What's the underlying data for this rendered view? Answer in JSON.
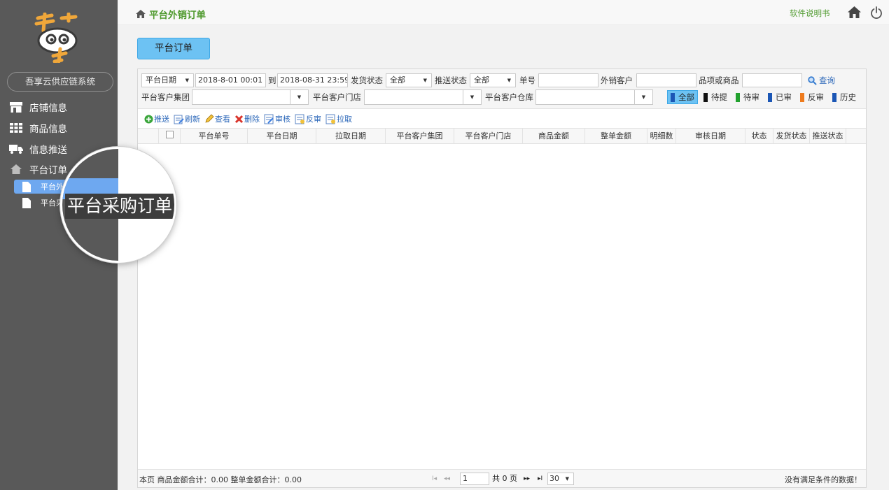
{
  "sidebar": {
    "system_name": "吾享云供应链系统",
    "menu": [
      {
        "label": "店铺信息",
        "icon": "store-icon"
      },
      {
        "label": "商品信息",
        "icon": "grid-icon"
      },
      {
        "label": "信息推送",
        "icon": "truck-icon"
      },
      {
        "label": "平台订单",
        "icon": "house-icon"
      }
    ],
    "submenu": [
      {
        "label": "平台外",
        "active": true
      },
      {
        "label": "平台采",
        "active": false
      }
    ],
    "magnified_label": "平台采购订单"
  },
  "header": {
    "breadcrumb": "平台外销订单",
    "manual_link": "软件说明书"
  },
  "tab_button": "平台订单",
  "filters": {
    "date_type": "平台日期",
    "date_from": "2018-8-01 00:01",
    "to_label": "到",
    "date_to": "2018-08-31 23:59",
    "ship_status_label": "发货状态",
    "ship_status_value": "全部",
    "push_status_label": "推送状态",
    "push_status_value": "全部",
    "order_no_label": "单号",
    "customer_label": "外销客户",
    "product_label": "品项或商品",
    "search_label": "查询",
    "group_label": "平台客户集团",
    "store_label": "平台客户门店",
    "warehouse_label": "平台客户仓库",
    "status_tags": [
      {
        "label": "全部",
        "color": "#1b56b5",
        "active": true
      },
      {
        "label": "待提",
        "color": "#111111",
        "active": false
      },
      {
        "label": "待审",
        "color": "#21a12e",
        "active": false
      },
      {
        "label": "已审",
        "color": "#1b56b5",
        "active": false
      },
      {
        "label": "反审",
        "color": "#ee7b1d",
        "active": false
      },
      {
        "label": "历史",
        "color": "#1b56b5",
        "active": false
      }
    ]
  },
  "toolbar": {
    "push": "推送",
    "refresh": "刷新",
    "view": "查看",
    "delete": "删除",
    "approve": "审核",
    "unapprove": "反审",
    "pull": "拉取"
  },
  "table": {
    "columns": [
      "平台单号",
      "平台日期",
      "拉取日期",
      "平台客户集团",
      "平台客户门店",
      "商品金额",
      "整单金额",
      "明细数",
      "审核日期",
      "状态",
      "发货状态",
      "推送状态"
    ]
  },
  "footer": {
    "summary": "本页 商品金额合计：0.00 整单金额合计：0.00",
    "page_value": "1",
    "total_pages": "共 0 页",
    "page_size": "30",
    "no_data": "没有满足条件的数据！"
  }
}
